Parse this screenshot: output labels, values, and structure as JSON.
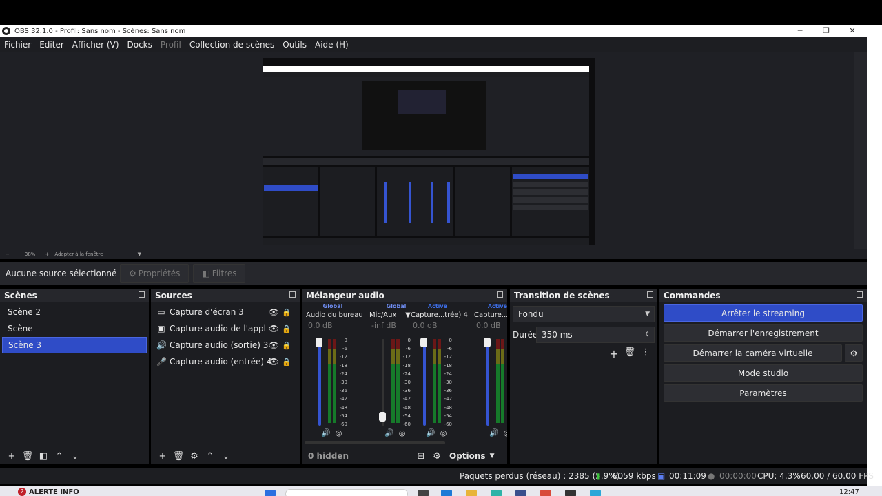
{
  "window": {
    "title": "OBS 32.1.0 - Profil: Sans nom - Scènes: Sans nom",
    "minimize": "─",
    "maximize": "❐",
    "close": "✕"
  },
  "menu": [
    "Fichier",
    "Editer",
    "Afficher (V)",
    "Docks",
    "Profil",
    "Collection de scènes",
    "Outils",
    "Aide (H)"
  ],
  "zoom": {
    "minus": "−",
    "value": "38%",
    "plus": "+",
    "fit": "Adapter à la fenêtre"
  },
  "source_toolbar": {
    "no_selection": "Aucune source sélectionné",
    "properties": "Propriétés",
    "filters": "Filtres"
  },
  "scenes": {
    "title": "Scènes",
    "items": [
      "Scène 2",
      "Scène",
      "Scène 3"
    ],
    "selected_index": 2
  },
  "sources": {
    "title": "Sources",
    "items": [
      {
        "icon": "monitor-icon",
        "label": "Capture d'écran 3"
      },
      {
        "icon": "app-window-icon",
        "label": "Capture audio de l'applicatic"
      },
      {
        "icon": "speaker-icon",
        "label": "Capture audio (sortie) 3"
      },
      {
        "icon": "microphone-icon",
        "label": "Capture audio (entrée) 4"
      }
    ]
  },
  "mixer": {
    "title": "Mélangeur audio",
    "channels": [
      {
        "badge": "Global",
        "name": "Audio du bureau",
        "db": "0.0 dB",
        "level": 1.0
      },
      {
        "badge": "Global",
        "name": "Mic/Aux",
        "db": "-inf dB",
        "level": 0.0
      },
      {
        "badge": "Active",
        "name": "Capture...trée) 4",
        "db": "0.0 dB",
        "level": 1.0
      },
      {
        "badge": "Active",
        "name": "Capture...rti",
        "db": "0.0 dB",
        "level": 1.0
      }
    ],
    "scale": [
      "0",
      "-6",
      "-12",
      "-18",
      "-24",
      "-30",
      "-36",
      "-42",
      "-48",
      "-54",
      "-60"
    ],
    "hidden": "0 hidden",
    "options": "Options"
  },
  "transition": {
    "title": "Transition de scènes",
    "type": "Fondu",
    "duration_label": "Durée",
    "duration_value": "350 ms"
  },
  "controls": {
    "title": "Commandes",
    "stop_streaming": "Arrêter le streaming",
    "start_recording": "Démarrer l'enregistrement",
    "start_virtual_camera": "Démarrer la caméra virtuelle",
    "studio_mode": "Mode studio",
    "settings": "Paramètres"
  },
  "status": {
    "dropped": "Paquets perdus (réseau) : 2385 (5.9%)",
    "bitrate": "6059 kbps",
    "stream_time": "00:11:09",
    "rec_time": "00:00:00",
    "cpu": "CPU: 4.3%",
    "fps": "60.00 / 60.00 FPS"
  },
  "taskbar": {
    "notification_count": "2",
    "alert": "ALERTE INFO",
    "clock": "12:47"
  },
  "colors": {
    "accent": "#2f4cc7",
    "background": "#1c1d21",
    "global_badge": "#6e8cf0",
    "active_badge": "#3d6ee8"
  }
}
